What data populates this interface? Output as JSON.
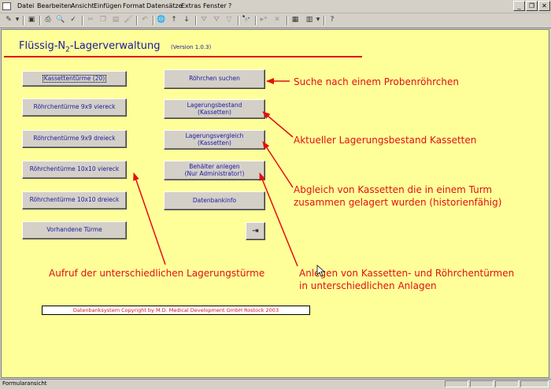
{
  "menu": [
    "Datei",
    "Bearbeiten",
    "Ansicht",
    "Einfügen",
    "Format",
    "Datensätze",
    "Extras",
    "Fenster",
    "?"
  ],
  "form": {
    "title_prefix": "Flüssig-N",
    "title_sub": "2",
    "title_suffix": "-Lagerverwaltung",
    "version": "(Version 1.0.3)"
  },
  "buttons": {
    "kassettentuerme": "Kassettentürme (20)",
    "roehrchentuerme_9x9_viereck": "Röhrchentürme 9x9 viereck",
    "roehrchentuerme_9x9_dreieck": "Röhrchentürme 9x9 dreieck",
    "roehrchentuerme_10x10_viereck": "Röhrchentürme 10x10 viereck",
    "roehrchentuerme_10x10_dreieck": "Röhrchentürme 10x10 dreieck",
    "vorhandene_tuerme": "Vorhandene Türme",
    "roehrchen_suchen": "Röhrchen suchen",
    "lagerungsbestand_l1": "Lagerungsbestand",
    "lagerungsbestand_l2": "(Kassetten)",
    "lagerungsvergleich_l1": "Lagerungsvergleich",
    "lagerungsvergleich_l2": "(Kassetten)",
    "behaelter_l1": "Behälter anlegen",
    "behaelter_l2": "(Nur Administrator!)",
    "datenbankinfo": "Datenbankinfo"
  },
  "annotations": {
    "suche": "Suche nach einem Probenröhrchen",
    "bestand": "Aktueller Lagerungsbestand Kassetten",
    "abgleich_l1": "Abgleich von Kassetten die in einem Turm",
    "abgleich_l2": "zusammen gelagert wurden (historienfähig)",
    "aufruf": "Aufruf der unterschiedlichen Lagerungstürme",
    "anlegen_l1": "Anlegen von Kassetten- und Röhrchentürmen",
    "anlegen_l2": "in unterschiedlichen Anlagen"
  },
  "copyright": "Datenbanksystem Copyright by M.D. Medical Development GmbH Rostock 2003",
  "status": {
    "text": "Formularansicht"
  },
  "colors": {
    "form_background": "#ffff99",
    "annotation_red": "#e01010",
    "label_blue": "#1a1aa0"
  }
}
